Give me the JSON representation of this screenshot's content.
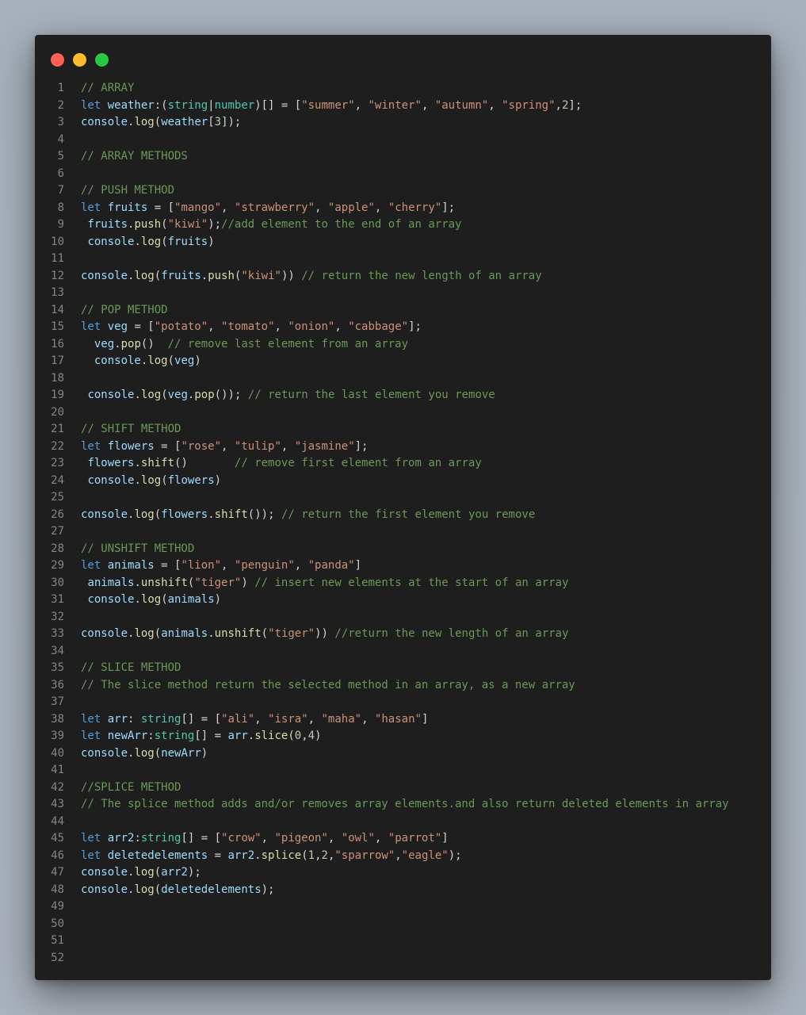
{
  "window": {
    "controls": [
      {
        "name": "close-button",
        "color": "#ff5f57"
      },
      {
        "name": "minimize-button",
        "color": "#febc2e"
      },
      {
        "name": "zoom-button",
        "color": "#28c840"
      }
    ]
  },
  "editor": {
    "lines": [
      {
        "n": "1",
        "t": [
          [
            "cm",
            "// ARRAY"
          ]
        ]
      },
      {
        "n": "2",
        "t": [
          [
            "kw",
            "let "
          ],
          [
            "vr",
            "weather"
          ],
          [
            "pn",
            ":("
          ],
          [
            "ty",
            "string"
          ],
          [
            "pn",
            "|"
          ],
          [
            "ty",
            "number"
          ],
          [
            "pn",
            ")[] = ["
          ],
          [
            "st",
            "\"summer\""
          ],
          [
            "pn",
            ", "
          ],
          [
            "st",
            "\"winter\""
          ],
          [
            "pn",
            ", "
          ],
          [
            "st",
            "\"autumn\""
          ],
          [
            "pn",
            ", "
          ],
          [
            "st",
            "\"spring\""
          ],
          [
            "pn",
            ","
          ],
          [
            "nm",
            "2"
          ],
          [
            "pn",
            "];"
          ]
        ]
      },
      {
        "n": "3",
        "t": [
          [
            "vr",
            "console"
          ],
          [
            "pn",
            "."
          ],
          [
            "fn",
            "log"
          ],
          [
            "pn",
            "("
          ],
          [
            "vr",
            "weather"
          ],
          [
            "pn",
            "["
          ],
          [
            "nm",
            "3"
          ],
          [
            "pn",
            "]);"
          ]
        ]
      },
      {
        "n": "4",
        "t": []
      },
      {
        "n": "5",
        "t": [
          [
            "cm",
            "// ARRAY METHODS"
          ]
        ]
      },
      {
        "n": "6",
        "t": []
      },
      {
        "n": "7",
        "t": [
          [
            "cm",
            "// PUSH METHOD"
          ]
        ]
      },
      {
        "n": "8",
        "t": [
          [
            "kw",
            "let "
          ],
          [
            "vr",
            "fruits"
          ],
          [
            "pn",
            " = ["
          ],
          [
            "st",
            "\"mango\""
          ],
          [
            "pn",
            ", "
          ],
          [
            "st",
            "\"strawberry\""
          ],
          [
            "pn",
            ", "
          ],
          [
            "st",
            "\"apple\""
          ],
          [
            "pn",
            ", "
          ],
          [
            "st",
            "\"cherry\""
          ],
          [
            "pn",
            "];"
          ]
        ]
      },
      {
        "n": "9",
        "t": [
          [
            "pn",
            " "
          ],
          [
            "vr",
            "fruits"
          ],
          [
            "pn",
            "."
          ],
          [
            "fn",
            "push"
          ],
          [
            "pn",
            "("
          ],
          [
            "st",
            "\"kiwi\""
          ],
          [
            "pn",
            ");"
          ],
          [
            "cm",
            "//add element to the end of an array"
          ]
        ]
      },
      {
        "n": "10",
        "t": [
          [
            "pn",
            " "
          ],
          [
            "vr",
            "console"
          ],
          [
            "pn",
            "."
          ],
          [
            "fn",
            "log"
          ],
          [
            "pn",
            "("
          ],
          [
            "vr",
            "fruits"
          ],
          [
            "pn",
            ")"
          ]
        ]
      },
      {
        "n": "11",
        "t": []
      },
      {
        "n": "12",
        "t": [
          [
            "vr",
            "console"
          ],
          [
            "pn",
            "."
          ],
          [
            "fn",
            "log"
          ],
          [
            "pn",
            "("
          ],
          [
            "vr",
            "fruits"
          ],
          [
            "pn",
            "."
          ],
          [
            "fn",
            "push"
          ],
          [
            "pn",
            "("
          ],
          [
            "st",
            "\"kiwi\""
          ],
          [
            "pn",
            "))"
          ],
          [
            "cm",
            " // return the new length of an array"
          ]
        ]
      },
      {
        "n": "13",
        "t": []
      },
      {
        "n": "14",
        "t": [
          [
            "cm",
            "// POP METHOD"
          ]
        ]
      },
      {
        "n": "15",
        "t": [
          [
            "kw",
            "let "
          ],
          [
            "vr",
            "veg"
          ],
          [
            "pn",
            " = ["
          ],
          [
            "st",
            "\"potato\""
          ],
          [
            "pn",
            ", "
          ],
          [
            "st",
            "\"tomato\""
          ],
          [
            "pn",
            ", "
          ],
          [
            "st",
            "\"onion\""
          ],
          [
            "pn",
            ", "
          ],
          [
            "st",
            "\"cabbage\""
          ],
          [
            "pn",
            "];"
          ]
        ]
      },
      {
        "n": "16",
        "t": [
          [
            "pn",
            "  "
          ],
          [
            "vr",
            "veg"
          ],
          [
            "pn",
            "."
          ],
          [
            "fn",
            "pop"
          ],
          [
            "pn",
            "()  "
          ],
          [
            "cm",
            "// remove last element from an array"
          ]
        ]
      },
      {
        "n": "17",
        "t": [
          [
            "pn",
            "  "
          ],
          [
            "vr",
            "console"
          ],
          [
            "pn",
            "."
          ],
          [
            "fn",
            "log"
          ],
          [
            "pn",
            "("
          ],
          [
            "vr",
            "veg"
          ],
          [
            "pn",
            ")"
          ]
        ]
      },
      {
        "n": "18",
        "t": []
      },
      {
        "n": "19",
        "t": [
          [
            "pn",
            " "
          ],
          [
            "vr",
            "console"
          ],
          [
            "pn",
            "."
          ],
          [
            "fn",
            "log"
          ],
          [
            "pn",
            "("
          ],
          [
            "vr",
            "veg"
          ],
          [
            "pn",
            "."
          ],
          [
            "fn",
            "pop"
          ],
          [
            "pn",
            "()); "
          ],
          [
            "cm",
            "// return the last element you remove"
          ]
        ]
      },
      {
        "n": "20",
        "t": []
      },
      {
        "n": "21",
        "t": [
          [
            "cm",
            "// SHIFT METHOD"
          ]
        ]
      },
      {
        "n": "22",
        "t": [
          [
            "kw",
            "let "
          ],
          [
            "vr",
            "flowers"
          ],
          [
            "pn",
            " = ["
          ],
          [
            "st",
            "\"rose\""
          ],
          [
            "pn",
            ", "
          ],
          [
            "st",
            "\"tulip\""
          ],
          [
            "pn",
            ", "
          ],
          [
            "st",
            "\"jasmine\""
          ],
          [
            "pn",
            "];"
          ]
        ]
      },
      {
        "n": "23",
        "t": [
          [
            "pn",
            " "
          ],
          [
            "vr",
            "flowers"
          ],
          [
            "pn",
            "."
          ],
          [
            "fn",
            "shift"
          ],
          [
            "pn",
            "()       "
          ],
          [
            "cm",
            "// remove first element from an array"
          ]
        ]
      },
      {
        "n": "24",
        "t": [
          [
            "pn",
            " "
          ],
          [
            "vr",
            "console"
          ],
          [
            "pn",
            "."
          ],
          [
            "fn",
            "log"
          ],
          [
            "pn",
            "("
          ],
          [
            "vr",
            "flowers"
          ],
          [
            "pn",
            ")"
          ]
        ]
      },
      {
        "n": "25",
        "t": []
      },
      {
        "n": "26",
        "t": [
          [
            "vr",
            "console"
          ],
          [
            "pn",
            "."
          ],
          [
            "fn",
            "log"
          ],
          [
            "pn",
            "("
          ],
          [
            "vr",
            "flowers"
          ],
          [
            "pn",
            "."
          ],
          [
            "fn",
            "shift"
          ],
          [
            "pn",
            "()); "
          ],
          [
            "cm",
            "// return the first element you remove"
          ]
        ]
      },
      {
        "n": "27",
        "t": []
      },
      {
        "n": "28",
        "t": [
          [
            "cm",
            "// UNSHIFT METHOD"
          ]
        ]
      },
      {
        "n": "29",
        "t": [
          [
            "kw",
            "let "
          ],
          [
            "vr",
            "animals"
          ],
          [
            "pn",
            " = ["
          ],
          [
            "st",
            "\"lion\""
          ],
          [
            "pn",
            ", "
          ],
          [
            "st",
            "\"penguin\""
          ],
          [
            "pn",
            ", "
          ],
          [
            "st",
            "\"panda\""
          ],
          [
            "pn",
            "]"
          ]
        ]
      },
      {
        "n": "30",
        "t": [
          [
            "pn",
            " "
          ],
          [
            "vr",
            "animals"
          ],
          [
            "pn",
            "."
          ],
          [
            "fn",
            "unshift"
          ],
          [
            "pn",
            "("
          ],
          [
            "st",
            "\"tiger\""
          ],
          [
            "pn",
            ") "
          ],
          [
            "cm",
            "// insert new elements at the start of an array"
          ]
        ]
      },
      {
        "n": "31",
        "t": [
          [
            "pn",
            " "
          ],
          [
            "vr",
            "console"
          ],
          [
            "pn",
            "."
          ],
          [
            "fn",
            "log"
          ],
          [
            "pn",
            "("
          ],
          [
            "vr",
            "animals"
          ],
          [
            "pn",
            ")"
          ]
        ]
      },
      {
        "n": "32",
        "t": []
      },
      {
        "n": "33",
        "t": [
          [
            "vr",
            "console"
          ],
          [
            "pn",
            "."
          ],
          [
            "fn",
            "log"
          ],
          [
            "pn",
            "("
          ],
          [
            "vr",
            "animals"
          ],
          [
            "pn",
            "."
          ],
          [
            "fn",
            "unshift"
          ],
          [
            "pn",
            "("
          ],
          [
            "st",
            "\"tiger\""
          ],
          [
            "pn",
            "))"
          ],
          [
            "cm",
            " //return the new length of an array"
          ]
        ]
      },
      {
        "n": "34",
        "t": []
      },
      {
        "n": "35",
        "t": [
          [
            "cm",
            "// SLICE METHOD"
          ]
        ]
      },
      {
        "n": "36",
        "t": [
          [
            "cm",
            "// The slice method return the selected method in an array, as a new array"
          ]
        ]
      },
      {
        "n": "37",
        "t": []
      },
      {
        "n": "38",
        "t": [
          [
            "kw",
            "let "
          ],
          [
            "vr",
            "arr"
          ],
          [
            "pn",
            ": "
          ],
          [
            "ty",
            "string"
          ],
          [
            "pn",
            "[] = ["
          ],
          [
            "st",
            "\"ali\""
          ],
          [
            "pn",
            ", "
          ],
          [
            "st",
            "\"isra\""
          ],
          [
            "pn",
            ", "
          ],
          [
            "st",
            "\"maha\""
          ],
          [
            "pn",
            ", "
          ],
          [
            "st",
            "\"hasan\""
          ],
          [
            "pn",
            "]"
          ]
        ]
      },
      {
        "n": "39",
        "t": [
          [
            "kw",
            "let "
          ],
          [
            "vr",
            "newArr"
          ],
          [
            "pn",
            ":"
          ],
          [
            "ty",
            "string"
          ],
          [
            "pn",
            "[] = "
          ],
          [
            "vr",
            "arr"
          ],
          [
            "pn",
            "."
          ],
          [
            "fn",
            "slice"
          ],
          [
            "pn",
            "("
          ],
          [
            "nm",
            "0"
          ],
          [
            "pn",
            ","
          ],
          [
            "nm",
            "4"
          ],
          [
            "pn",
            ")"
          ]
        ]
      },
      {
        "n": "40",
        "t": [
          [
            "vr",
            "console"
          ],
          [
            "pn",
            "."
          ],
          [
            "fn",
            "log"
          ],
          [
            "pn",
            "("
          ],
          [
            "vr",
            "newArr"
          ],
          [
            "pn",
            ")"
          ]
        ]
      },
      {
        "n": "41",
        "t": []
      },
      {
        "n": "42",
        "t": [
          [
            "cm",
            "//SPLICE METHOD"
          ]
        ]
      },
      {
        "n": "43",
        "t": [
          [
            "cm",
            "// The splice method adds and/or removes array elements.and also return deleted elements in array"
          ]
        ]
      },
      {
        "n": "44",
        "t": []
      },
      {
        "n": "45",
        "t": [
          [
            "kw",
            "let "
          ],
          [
            "vr",
            "arr2"
          ],
          [
            "pn",
            ":"
          ],
          [
            "ty",
            "string"
          ],
          [
            "pn",
            "[] = ["
          ],
          [
            "st",
            "\"crow\""
          ],
          [
            "pn",
            ", "
          ],
          [
            "st",
            "\"pigeon\""
          ],
          [
            "pn",
            ", "
          ],
          [
            "st",
            "\"owl\""
          ],
          [
            "pn",
            ", "
          ],
          [
            "st",
            "\"parrot\""
          ],
          [
            "pn",
            "]"
          ]
        ]
      },
      {
        "n": "46",
        "t": [
          [
            "kw",
            "let "
          ],
          [
            "vr",
            "deletedelements"
          ],
          [
            "pn",
            " = "
          ],
          [
            "vr",
            "arr2"
          ],
          [
            "pn",
            "."
          ],
          [
            "fn",
            "splice"
          ],
          [
            "pn",
            "("
          ],
          [
            "nm",
            "1"
          ],
          [
            "pn",
            ","
          ],
          [
            "nm",
            "2"
          ],
          [
            "pn",
            ","
          ],
          [
            "st",
            "\"sparrow\""
          ],
          [
            "pn",
            ","
          ],
          [
            "st",
            "\"eagle\""
          ],
          [
            "pn",
            ");"
          ]
        ]
      },
      {
        "n": "47",
        "t": [
          [
            "vr",
            "console"
          ],
          [
            "pn",
            "."
          ],
          [
            "fn",
            "log"
          ],
          [
            "pn",
            "("
          ],
          [
            "vr",
            "arr2"
          ],
          [
            "pn",
            ");"
          ]
        ]
      },
      {
        "n": "48",
        "t": [
          [
            "vr",
            "console"
          ],
          [
            "pn",
            "."
          ],
          [
            "fn",
            "log"
          ],
          [
            "pn",
            "("
          ],
          [
            "vr",
            "deletedelements"
          ],
          [
            "pn",
            ");"
          ]
        ]
      },
      {
        "n": "49",
        "t": []
      },
      {
        "n": "50",
        "t": []
      },
      {
        "n": "51",
        "t": []
      },
      {
        "n": "52",
        "t": []
      }
    ]
  }
}
